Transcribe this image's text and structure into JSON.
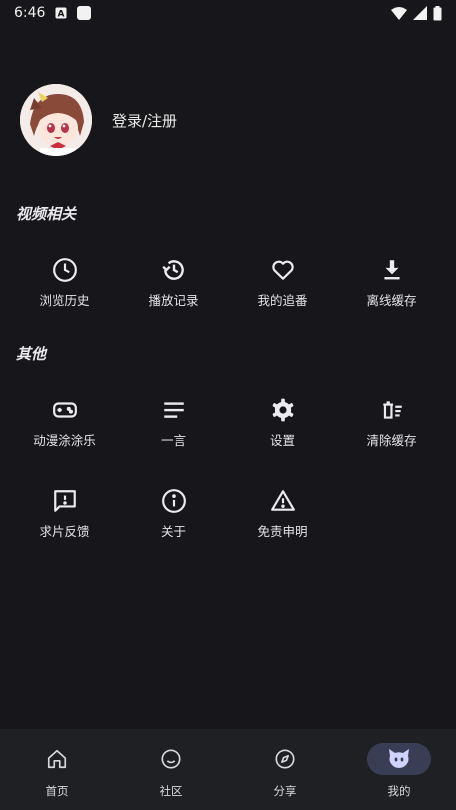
{
  "status_bar": {
    "time": "6:46"
  },
  "profile": {
    "login_label": "登录/注册"
  },
  "sections": {
    "video": {
      "title": "视频相关",
      "items": [
        {
          "label": "浏览历史",
          "icon": "clock-icon"
        },
        {
          "label": "播放记录",
          "icon": "history-icon"
        },
        {
          "label": "我的追番",
          "icon": "heart-icon"
        },
        {
          "label": "离线缓存",
          "icon": "download-icon"
        }
      ]
    },
    "other": {
      "title": "其他",
      "items": [
        {
          "label": "动漫涂涂乐",
          "icon": "gamepad-icon"
        },
        {
          "label": "一言",
          "icon": "lines-icon"
        },
        {
          "label": "设置",
          "icon": "gear-icon"
        },
        {
          "label": "清除缓存",
          "icon": "clear-cache-icon"
        },
        {
          "label": "求片反馈",
          "icon": "feedback-icon"
        },
        {
          "label": "关于",
          "icon": "info-icon"
        },
        {
          "label": "免责申明",
          "icon": "warning-icon"
        }
      ]
    }
  },
  "bottom_nav": {
    "items": [
      {
        "label": "首页",
        "icon": "home-icon"
      },
      {
        "label": "社区",
        "icon": "smile-icon"
      },
      {
        "label": "分享",
        "icon": "compass-icon"
      },
      {
        "label": "我的",
        "icon": "mascot-icon",
        "active": true
      }
    ]
  },
  "colors": {
    "background": "#17171b",
    "nav_background": "#1f2024",
    "active_pill": "#3a3e55"
  }
}
